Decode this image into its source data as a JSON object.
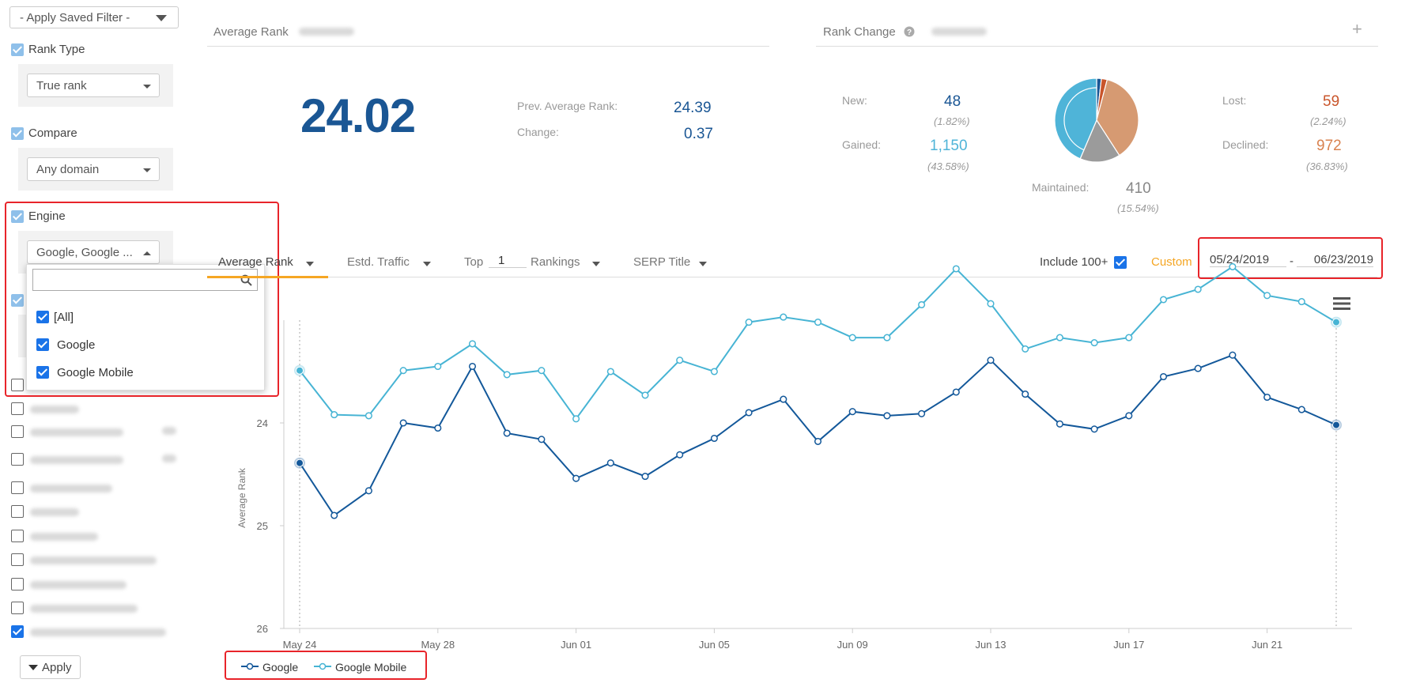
{
  "sidebar": {
    "saved_filter": "- Apply Saved Filter -",
    "rank_type": {
      "label": "Rank Type",
      "value": "True rank"
    },
    "compare": {
      "label": "Compare",
      "value": "Any domain"
    },
    "engine": {
      "label": "Engine",
      "value": "Google, Google ...",
      "options": [
        "[All]",
        "Google",
        "Google Mobile"
      ]
    },
    "apply_label": "Apply"
  },
  "average_rank": {
    "title": "Average Rank",
    "value": "24.02",
    "prev_label": "Prev. Average Rank:",
    "prev_value": "24.39",
    "change_label": "Change:",
    "change_value": "0.37"
  },
  "rank_change": {
    "title": "Rank Change",
    "new_label": "New:",
    "new_value": "48",
    "new_pct": "(1.82%)",
    "gained_label": "Gained:",
    "gained_value": "1,150",
    "gained_pct": "(43.58%)",
    "lost_label": "Lost:",
    "lost_value": "59",
    "lost_pct": "(2.24%)",
    "declined_label": "Declined:",
    "declined_value": "972",
    "declined_pct": "(36.83%)",
    "maintained_label": "Maintained:",
    "maintained_value": "410",
    "maintained_pct": "(15.54%)",
    "pie": [
      {
        "name": "New",
        "value": 48,
        "color": "#1a5694"
      },
      {
        "name": "Lost",
        "value": 59,
        "color": "#c9552b"
      },
      {
        "name": "Declined",
        "value": 972,
        "color": "#d69a72"
      },
      {
        "name": "Maintained",
        "value": 410,
        "color": "#9b9b9b"
      },
      {
        "name": "Gained",
        "value": 1150,
        "color": "#4fb4d8"
      }
    ]
  },
  "tabs": {
    "average_rank": "Average Rank",
    "traffic": "Estd. Traffic",
    "top": "Top",
    "top_value": "1",
    "rankings": "Rankings",
    "serp": "SERP Title",
    "include": "Include 100+",
    "custom": "Custom",
    "date_from": "05/24/2019",
    "date_sep": "-",
    "date_to": "06/23/2019"
  },
  "colors": {
    "google": "#13589a",
    "google_mobile": "#47b4d4",
    "accent": "#f5a623"
  },
  "chart_data": {
    "type": "line",
    "ylabel": "Average Rank",
    "ylim": [
      23,
      26
    ],
    "y_inverted": true,
    "yticks": [
      24,
      25,
      26
    ],
    "ytick_labels": [
      "24",
      "25",
      "26"
    ],
    "x": [
      "May 24",
      "May 25",
      "May 26",
      "May 27",
      "May 28",
      "May 29",
      "May 30",
      "May 31",
      "Jun 01",
      "Jun 02",
      "Jun 03",
      "Jun 04",
      "Jun 05",
      "Jun 06",
      "Jun 07",
      "Jun 08",
      "Jun 09",
      "Jun 10",
      "Jun 11",
      "Jun 12",
      "Jun 13",
      "Jun 14",
      "Jun 15",
      "Jun 16",
      "Jun 17",
      "Jun 18",
      "Jun 19",
      "Jun 20",
      "Jun 21",
      "Jun 22",
      "Jun 23"
    ],
    "xtick_labels": [
      "May 24",
      "May 28",
      "Jun 01",
      "Jun 05",
      "Jun 09",
      "Jun 13",
      "Jun 17",
      "Jun 21"
    ],
    "series": [
      {
        "name": "Google",
        "color": "#13589a",
        "values": [
          24.39,
          24.9,
          24.66,
          24.0,
          24.05,
          23.45,
          24.1,
          24.16,
          24.54,
          24.39,
          24.52,
          24.31,
          24.15,
          23.9,
          23.77,
          24.18,
          23.89,
          23.93,
          23.91,
          23.7,
          23.39,
          23.72,
          24.01,
          24.06,
          23.93,
          23.55,
          23.47,
          23.34,
          23.75,
          23.87,
          24.02
        ]
      },
      {
        "name": "Google Mobile",
        "color": "#47b4d4",
        "values": [
          23.49,
          23.92,
          23.93,
          23.49,
          23.45,
          23.23,
          23.53,
          23.49,
          23.96,
          23.5,
          23.73,
          23.39,
          23.5,
          23.02,
          22.97,
          23.02,
          23.17,
          23.17,
          22.85,
          22.5,
          22.84,
          23.28,
          23.17,
          23.22,
          23.17,
          22.8,
          22.7,
          22.48,
          22.76,
          22.82,
          23.02
        ]
      }
    ]
  }
}
